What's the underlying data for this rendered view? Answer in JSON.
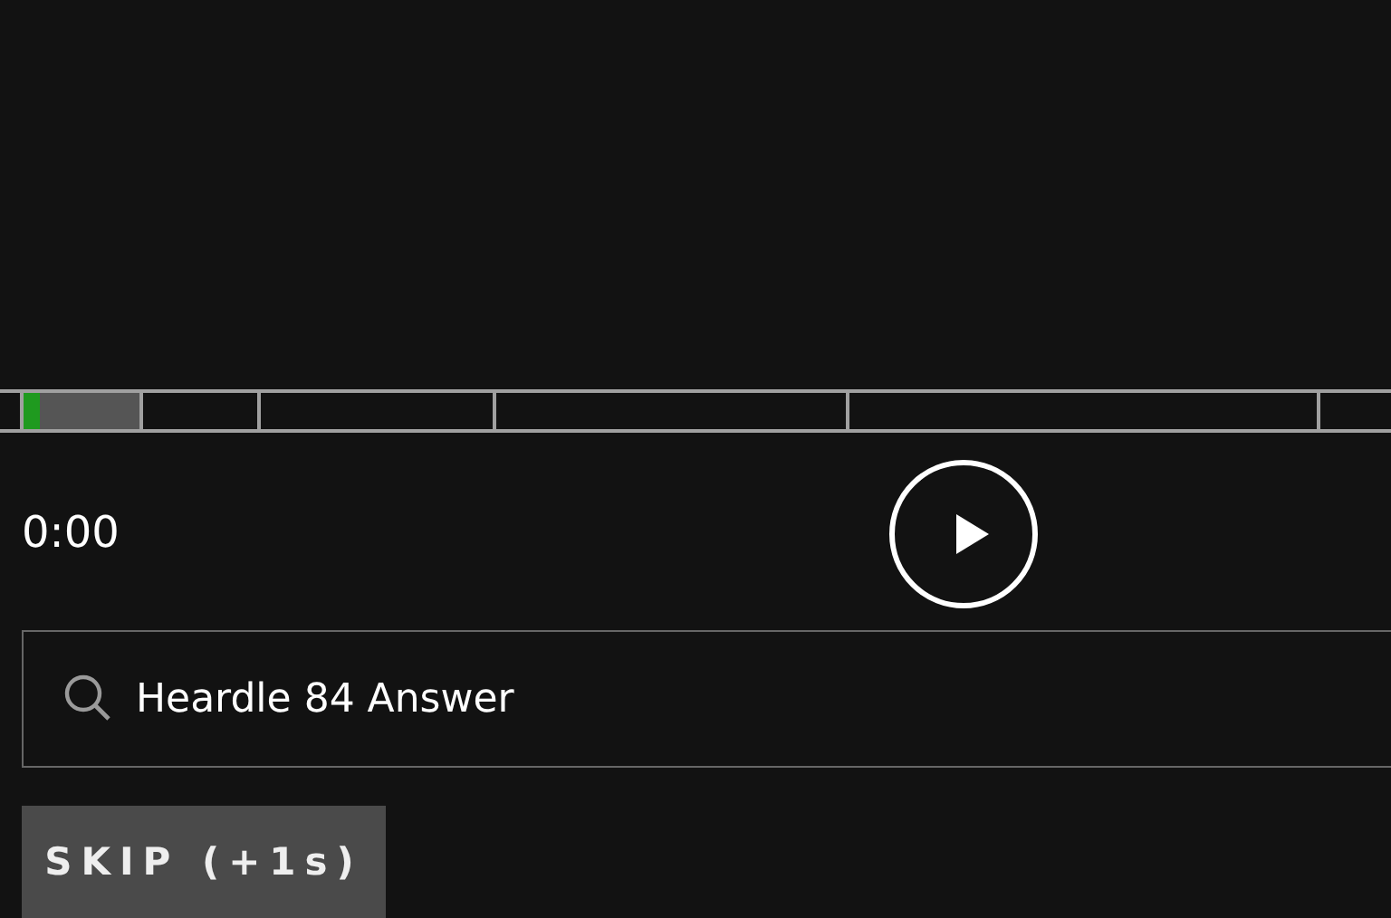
{
  "timeline": {
    "segments": [
      {
        "unlocked": true
      },
      {
        "unlocked": false
      },
      {
        "unlocked": false
      },
      {
        "unlocked": false
      },
      {
        "unlocked": false
      },
      {
        "unlocked": false
      }
    ],
    "progress": {
      "level": 0.14
    }
  },
  "player": {
    "time": "0:00",
    "playing": false
  },
  "search": {
    "value": "Heardle 84 Answer"
  },
  "skip_button": {
    "label": "SKIP (+1s)"
  }
}
